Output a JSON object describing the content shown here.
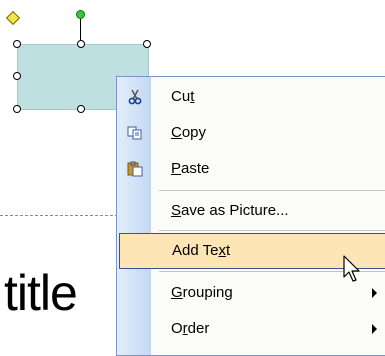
{
  "slide": {
    "title_text": "title"
  },
  "context_menu": {
    "items": [
      {
        "id": "cut",
        "pre": "Cu",
        "mnemonic": "t",
        "post": "",
        "icon": "scissors-icon"
      },
      {
        "id": "copy",
        "pre": "",
        "mnemonic": "C",
        "post": "opy",
        "icon": "copy-icon"
      },
      {
        "id": "paste",
        "pre": "",
        "mnemonic": "P",
        "post": "aste",
        "icon": "paste-icon"
      },
      {
        "id": "save-as-picture",
        "pre": "",
        "mnemonic": "S",
        "post": "ave as Picture...",
        "icon": ""
      },
      {
        "id": "add-text",
        "pre": "Add Te",
        "mnemonic": "x",
        "post": "t",
        "icon": ""
      },
      {
        "id": "grouping",
        "pre": "",
        "mnemonic": "G",
        "post": "rouping",
        "icon": "",
        "submenu": true
      },
      {
        "id": "order",
        "pre": "O",
        "mnemonic": "r",
        "post": "der",
        "icon": "",
        "submenu": true
      }
    ],
    "highlighted": "add-text"
  },
  "colors": {
    "shape_fill": "#bfe0e1",
    "menu_highlight": "#fde5b6",
    "menu_border": "#7a96c4",
    "rotation_handle": "#37c837",
    "adjust_handle": "#f1e64a"
  }
}
